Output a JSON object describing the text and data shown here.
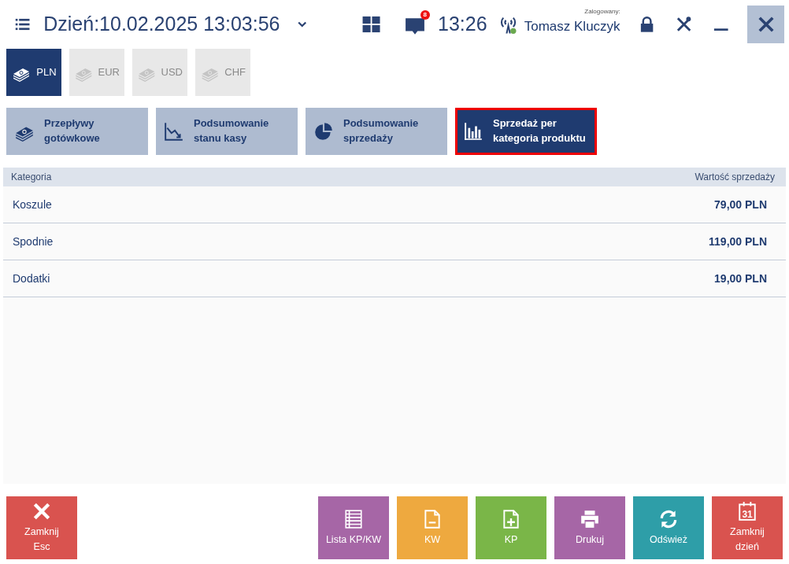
{
  "header": {
    "date_label": "Dzień:10.02.2025 13:03:56",
    "notification_count": "8",
    "clock": "13:26",
    "user_caption": "Zalogowany:",
    "user_name": "Tomasz Kluczyk"
  },
  "currencies": [
    {
      "label": "PLN",
      "selected": true
    },
    {
      "label": "EUR",
      "selected": false
    },
    {
      "label": "USD",
      "selected": false
    },
    {
      "label": "CHF",
      "selected": false
    }
  ],
  "views": [
    {
      "kind": "cash",
      "lines": [
        "Przepływy",
        "gotówkowe"
      ],
      "selected": false
    },
    {
      "kind": "line-chart",
      "lines": [
        "Podsumowanie",
        "stanu kasy"
      ],
      "selected": false
    },
    {
      "kind": "pie",
      "lines": [
        "Podsumowanie",
        "sprzedaży"
      ],
      "selected": false
    },
    {
      "kind": "bar-chart",
      "lines": [
        "Sprzedaż per",
        "kategoria produktu"
      ],
      "selected": true
    }
  ],
  "table": {
    "columns": [
      "Kategoria",
      "Wartość sprzedaży"
    ],
    "rows": [
      {
        "category": "Koszule",
        "value": "79,00 PLN"
      },
      {
        "category": "Spodnie",
        "value": "119,00 PLN"
      },
      {
        "category": "Dodatki",
        "value": "19,00 PLN"
      }
    ]
  },
  "buttons": [
    {
      "kind": "close",
      "lines": [
        "Zamknij",
        "Esc"
      ],
      "color": "#d9534f"
    },
    {
      "kind": "list",
      "lines": [
        "Lista KP/KW"
      ],
      "color": "#a666a6"
    },
    {
      "kind": "doc-minus",
      "lines": [
        "KW"
      ],
      "color": "#eea93f"
    },
    {
      "kind": "doc-plus",
      "lines": [
        "KP"
      ],
      "color": "#7ab648"
    },
    {
      "kind": "print",
      "lines": [
        "Drukuj"
      ],
      "color": "#a666a6"
    },
    {
      "kind": "refresh",
      "lines": [
        "Odśwież"
      ],
      "color": "#2e9ea8"
    },
    {
      "kind": "calendar",
      "lines": [
        "Zamknij",
        "dzień"
      ],
      "color": "#d9534f",
      "icon_text": "31"
    }
  ]
}
